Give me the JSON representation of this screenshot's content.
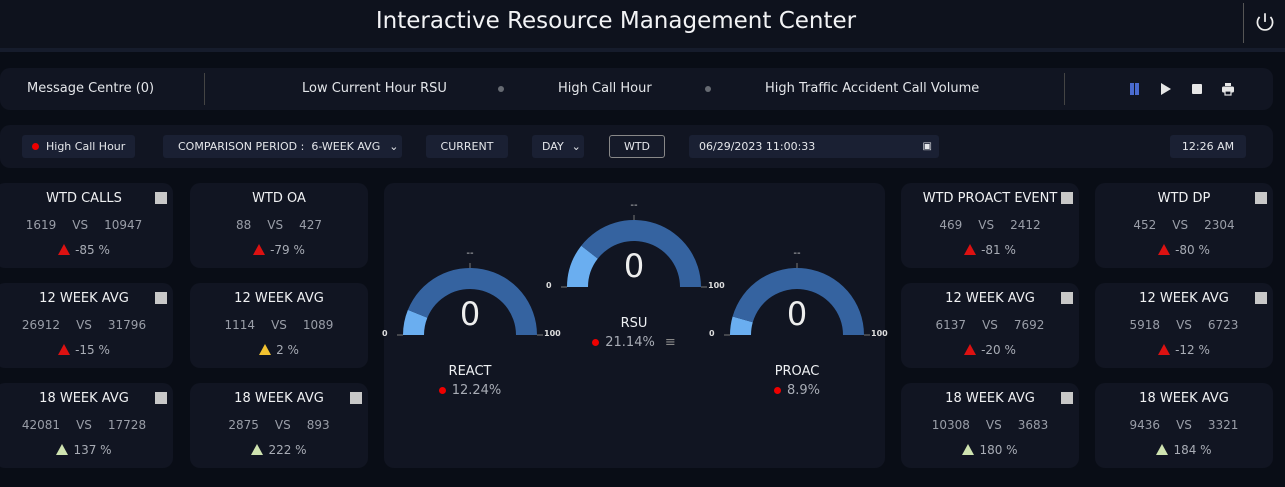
{
  "header": {
    "title": "Interactive Resource Management Center",
    "power_icon": "power-icon"
  },
  "message_bar": {
    "message_centre": "Message Centre (0)",
    "alerts": [
      "Low Current Hour RSU",
      "High Call Hour",
      "High Traffic Accident Call Volume"
    ],
    "controls": [
      "pause",
      "play",
      "stop",
      "print"
    ],
    "pause_color": "#4a6bd0"
  },
  "filter_bar": {
    "status": "High Call Hour",
    "comparison_label": "COMPARISON PERIOD :",
    "comparison_value": "6-WEEK AVG",
    "current": "CURRENT",
    "period": "DAY",
    "wtd": "WTD",
    "datetime": "06/29/2023 11:00:33",
    "clock": "12:26 AM"
  },
  "cards_left": [
    {
      "title": "WTD CALLS",
      "a": "1619",
      "b": "10947",
      "pct": "-85 %",
      "level": "red",
      "expand": true
    },
    {
      "title": "WTD OA",
      "a": "88",
      "b": "427",
      "pct": "-79 %",
      "level": "red",
      "expand": false
    },
    {
      "title": "12 WEEK AVG",
      "a": "26912",
      "b": "31796",
      "pct": "-15 %",
      "level": "red",
      "expand": true
    },
    {
      "title": "12 WEEK AVG",
      "a": "1114",
      "b": "1089",
      "pct": "2 %",
      "level": "yellow",
      "expand": false
    },
    {
      "title": "18 WEEK AVG",
      "a": "42081",
      "b": "17728",
      "pct": "137 %",
      "level": "green",
      "expand": true
    },
    {
      "title": "18 WEEK AVG",
      "a": "2875",
      "b": "893",
      "pct": "222 %",
      "level": "green",
      "expand": true
    }
  ],
  "cards_right": [
    {
      "title": "WTD PROACT EVENT",
      "a": "469",
      "b": "2412",
      "pct": "-81 %",
      "level": "red",
      "expand": true
    },
    {
      "title": "WTD DP",
      "a": "452",
      "b": "2304",
      "pct": "-80 %",
      "level": "red",
      "expand": true
    },
    {
      "title": "12 WEEK AVG",
      "a": "6137",
      "b": "7692",
      "pct": "-20 %",
      "level": "red",
      "expand": true
    },
    {
      "title": "12 WEEK AVG",
      "a": "5918",
      "b": "6723",
      "pct": "-12 %",
      "level": "red",
      "expand": true
    },
    {
      "title": "18 WEEK AVG",
      "a": "10308",
      "b": "3683",
      "pct": "180 %",
      "level": "green",
      "expand": true
    },
    {
      "title": "18 WEEK AVG",
      "a": "9436",
      "b": "3321",
      "pct": "184 %",
      "level": "green",
      "expand": false
    }
  ],
  "vs": "VS",
  "gauges": [
    {
      "name": "REACT",
      "value": "0",
      "min": "0",
      "max": "100",
      "target": "--",
      "pct": "12.24%",
      "fill": 12.24
    },
    {
      "name": "RSU",
      "value": "0",
      "min": "0",
      "max": "100",
      "target": "--",
      "pct": "21.14%",
      "fill": 21.14,
      "menu": true
    },
    {
      "name": "PROAC",
      "value": "0",
      "min": "0",
      "max": "100",
      "target": "--",
      "pct": "8.9%",
      "fill": 8.9
    }
  ],
  "colors": {
    "gauge_track": "#3563a0",
    "gauge_fill": "#6aaef0",
    "alert_dot": "#e00000"
  }
}
